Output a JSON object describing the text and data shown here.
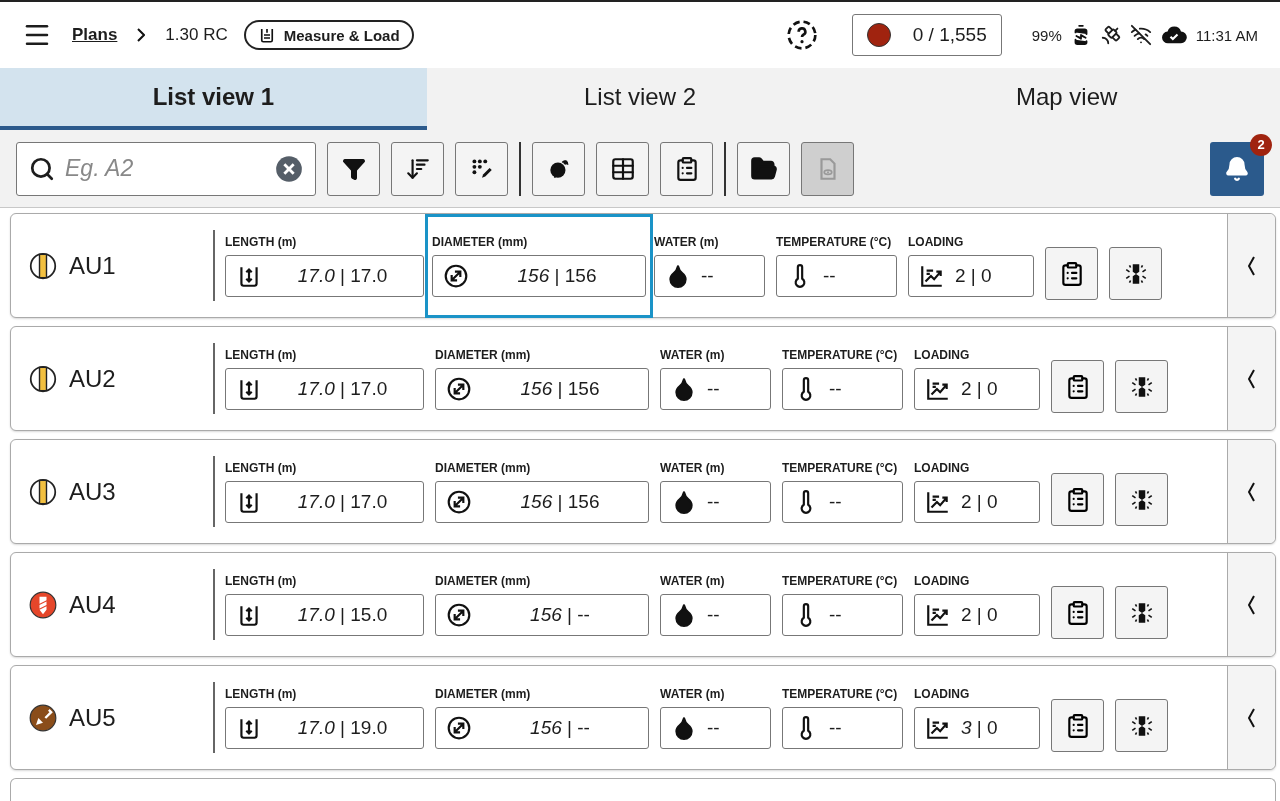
{
  "header": {
    "breadcrumb": [
      {
        "label": "Plans",
        "kind": "link"
      },
      {
        "label": "1.30 RC",
        "kind": "text"
      }
    ],
    "mode_pill": "Measure & Load",
    "counter": {
      "recording": true,
      "text": "0 / 1,555"
    },
    "battery": "99%",
    "time": "11:31 AM"
  },
  "tabs": [
    {
      "label": "List view 1",
      "selected": true
    },
    {
      "label": "List view 2",
      "selected": false
    },
    {
      "label": "Map view",
      "selected": false
    }
  ],
  "toolbar": {
    "search": {
      "placeholder": "Eg. A2"
    },
    "button_groups": [
      [
        {
          "kind": "filter",
          "disabled": false
        },
        {
          "kind": "sort",
          "disabled": false
        },
        {
          "kind": "dots-edit",
          "disabled": false
        }
      ],
      [
        {
          "kind": "ball",
          "disabled": false
        },
        {
          "kind": "table",
          "disabled": false
        },
        {
          "kind": "clipboard",
          "disabled": false
        }
      ],
      [
        {
          "kind": "folder",
          "disabled": false
        },
        {
          "kind": "document-preview",
          "disabled": true
        }
      ]
    ],
    "notifications": "2"
  },
  "rows": [
    {
      "name": "AU1",
      "kind": "striped",
      "fields": [
        {
          "kind": "length",
          "label": "LENGTH (m)",
          "value": "*17.0* | 17.0",
          "selected": false
        },
        {
          "kind": "diameter",
          "label": "DIAMETER (mm)",
          "value": "*156* | 156",
          "selected": true
        },
        {
          "kind": "water",
          "label": "WATER (m)",
          "value": "--",
          "selected": false
        },
        {
          "kind": "temperature",
          "label": "TEMPERATURE (°C)",
          "value": "--",
          "selected": false
        },
        {
          "kind": "loading",
          "label": "LOADING",
          "value": "2 | 0",
          "selected": false
        }
      ]
    },
    {
      "name": "AU2",
      "kind": "striped",
      "fields": [
        {
          "kind": "length",
          "label": "LENGTH (m)",
          "value": "*17.0* | 17.0",
          "selected": false
        },
        {
          "kind": "diameter",
          "label": "DIAMETER (mm)",
          "value": "*156* | 156",
          "selected": false
        },
        {
          "kind": "water",
          "label": "WATER (m)",
          "value": "--",
          "selected": false
        },
        {
          "kind": "temperature",
          "label": "TEMPERATURE (°C)",
          "value": "--",
          "selected": false
        },
        {
          "kind": "loading",
          "label": "LOADING",
          "value": "2 | 0",
          "selected": false
        }
      ]
    },
    {
      "name": "AU3",
      "kind": "striped",
      "fields": [
        {
          "kind": "length",
          "label": "LENGTH (m)",
          "value": "*17.0* | 17.0",
          "selected": false
        },
        {
          "kind": "diameter",
          "label": "DIAMETER (mm)",
          "value": "*156* | 156",
          "selected": false
        },
        {
          "kind": "water",
          "label": "WATER (m)",
          "value": "--",
          "selected": false
        },
        {
          "kind": "temperature",
          "label": "TEMPERATURE (°C)",
          "value": "--",
          "selected": false
        },
        {
          "kind": "loading",
          "label": "LOADING",
          "value": "2 | 0",
          "selected": false
        }
      ]
    },
    {
      "name": "AU4",
      "kind": "drilling",
      "fields": [
        {
          "kind": "length",
          "label": "LENGTH (m)",
          "value": "*17.0* | 15.0",
          "selected": false
        },
        {
          "kind": "diameter",
          "label": "DIAMETER (mm)",
          "value": "*156* | --",
          "selected": false
        },
        {
          "kind": "water",
          "label": "WATER (m)",
          "value": "--",
          "selected": false
        },
        {
          "kind": "temperature",
          "label": "TEMPERATURE (°C)",
          "value": "--",
          "selected": false
        },
        {
          "kind": "loading",
          "label": "LOADING",
          "value": "2 | 0",
          "selected": false
        }
      ]
    },
    {
      "name": "AU5",
      "kind": "digging",
      "fields": [
        {
          "kind": "length",
          "label": "LENGTH (m)",
          "value": "*17.0* | 19.0",
          "selected": false
        },
        {
          "kind": "diameter",
          "label": "DIAMETER (mm)",
          "value": "*156* | --",
          "selected": false
        },
        {
          "kind": "water",
          "label": "WATER (m)",
          "value": "--",
          "selected": false
        },
        {
          "kind": "temperature",
          "label": "TEMPERATURE (°C)",
          "value": "--",
          "selected": false
        },
        {
          "kind": "loading",
          "label": "LOADING",
          "value": "*3* | 0",
          "selected": false
        }
      ]
    }
  ]
}
